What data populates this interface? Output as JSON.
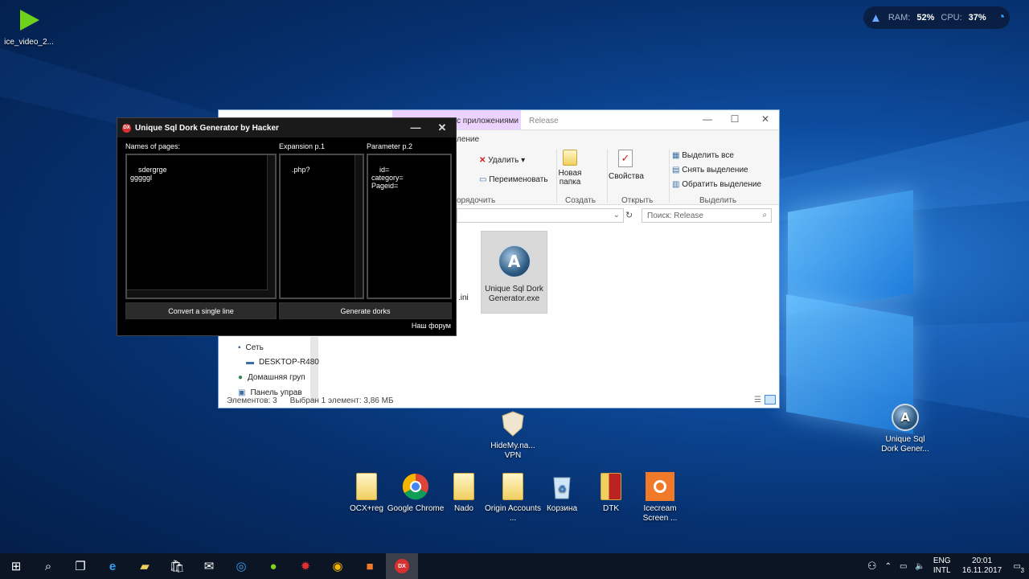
{
  "desktop": {
    "icons_top_left": [
      {
        "label": "ice_video_2..."
      }
    ],
    "widget": {
      "ram_label": "RAM:",
      "ram_value": "52%",
      "cpu_label": "CPU:",
      "cpu_value": "37%"
    },
    "icons_bottom": [
      {
        "label": "OCX+reg"
      },
      {
        "label": "Google Chrome"
      },
      {
        "label": "Nado"
      },
      {
        "label": "Origin Accounts ..."
      },
      {
        "label": "Корзина"
      },
      {
        "label": "DTK"
      },
      {
        "label": "Icecream Screen ..."
      }
    ],
    "icon_hidemy": {
      "label": "HideMy.na... VPN"
    },
    "icon_right": {
      "label": "Unique Sql Dork Gener..."
    }
  },
  "explorer": {
    "context_tab": "с приложениями",
    "context_sub": "ление",
    "title_tab": "Release",
    "ribbon": {
      "delete": "Удалить",
      "rename": "Переименовать",
      "arrange": "орядочить",
      "new_folder_1": "Новая",
      "new_folder_2": "папка",
      "create": "Создать",
      "properties": "Свойства",
      "open": "Открыть",
      "select_all": "Выделить все",
      "select_none": "Снять выделение",
      "invert": "Обратить выделение",
      "select_group": "Выделить"
    },
    "search_placeholder": "Поиск: Release",
    "file": {
      "name_1": "Unique Sql Dork",
      "name_2": "Generator.exe"
    },
    "partial_file": ".ini",
    "nav": [
      {
        "label": "Сеть"
      },
      {
        "label": "DESKTOP-R480"
      },
      {
        "label": "Домашняя груп"
      },
      {
        "label": "Панель управ"
      }
    ],
    "status_items": "Элементов: 3",
    "status_selected": "Выбран 1 элемент: 3,86 МБ"
  },
  "dork": {
    "title": "Unique Sql Dork Generator by Hacker",
    "logo": "DX",
    "label_names": "Names of pages:",
    "label_expansion": "Expansion p.1",
    "label_param": "Parameter p.2",
    "names_text": "sdergrge\ngggggl",
    "expansion_text": ".php?",
    "param_text": "id=\ncategory=\nPageid=",
    "btn_convert": "Convert a single line",
    "btn_generate": "Generate dorks",
    "forum": "Наш форум"
  },
  "taskbar": {
    "lang_1": "ENG",
    "lang_2": "INTL",
    "time": "20:01",
    "date": "16.11.2017",
    "notif_count": "3"
  }
}
